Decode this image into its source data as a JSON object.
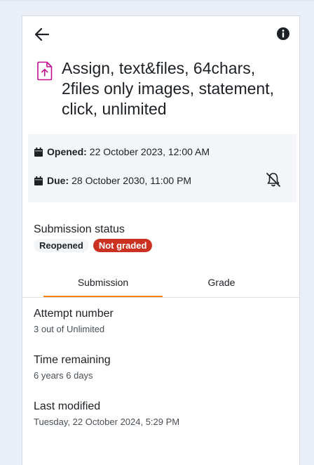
{
  "header": {
    "back_icon": "arrow-left-icon",
    "info_icon": "info-circle-icon"
  },
  "activity": {
    "icon": "assignment-upload-icon",
    "icon_color": "#c20e8f",
    "title": "Assign, text&files, 64chars, 2files only images, statement, click, unlimited"
  },
  "dates": {
    "opened_label": "Opened:",
    "opened_value": "22 October 2023, 12:00 AM",
    "due_label": "Due:",
    "due_value": "28 October 2030, 11:00 PM",
    "calendar_icon": "calendar-icon",
    "notification_icon": "bell-slash-icon"
  },
  "submission_status": {
    "label": "Submission status",
    "badges": [
      {
        "text": "Reopened",
        "color": "#f4f5f7"
      },
      {
        "text": "Not graded",
        "color": "#ca3120"
      }
    ]
  },
  "tabs": [
    {
      "label": "Submission",
      "active": true
    },
    {
      "label": "Grade",
      "active": false
    }
  ],
  "accent_color": "#f98012",
  "fields": [
    {
      "label": "Attempt number",
      "value": "3 out of Unlimited"
    },
    {
      "label": "Time remaining",
      "value": "6 years 6 days"
    },
    {
      "label": "Last modified",
      "value": "Tuesday, 22 October 2024, 5:29 PM"
    }
  ]
}
